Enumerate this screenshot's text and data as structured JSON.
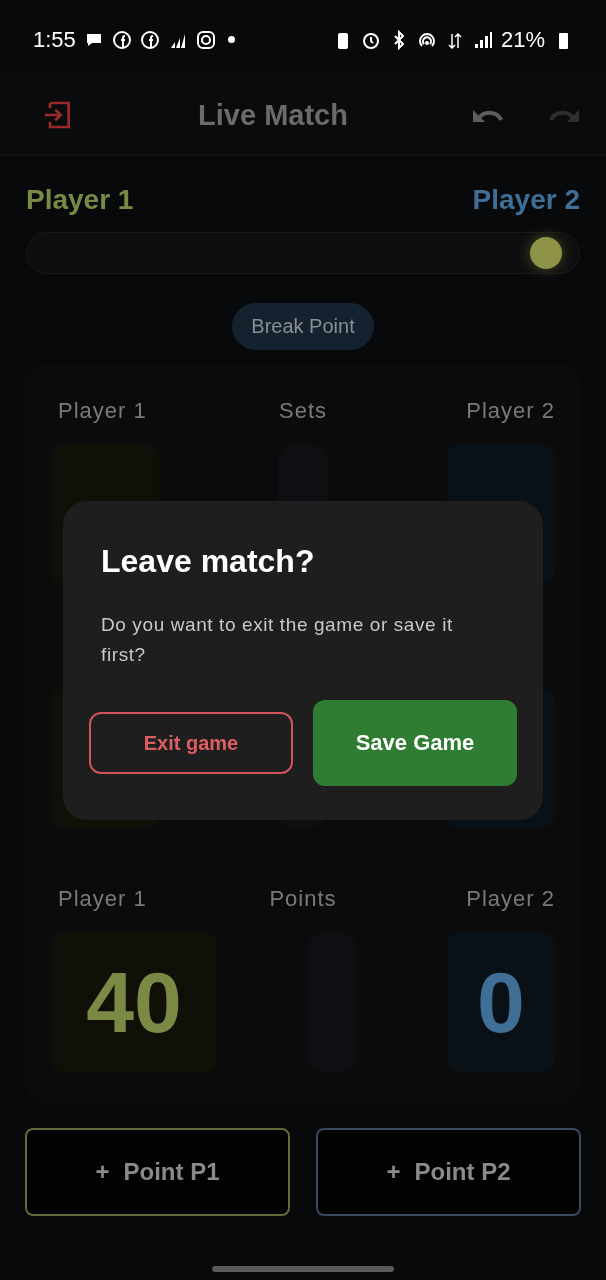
{
  "status_bar": {
    "time": "1:55",
    "battery_text": "21%"
  },
  "app_bar": {
    "title": "Live Match"
  },
  "players": [
    {
      "name": "Player 1",
      "color": "#7a8a45"
    },
    {
      "name": "Player 2",
      "color": "#3f6f96"
    }
  ],
  "momentum": {
    "level": 0.94
  },
  "badge": "Break Point",
  "sections": [
    {
      "kind": "sets",
      "labels": [
        "Player 1",
        "Sets",
        "Player 2"
      ]
    },
    {
      "kind": "games"
    },
    {
      "kind": "points",
      "labels": [
        "Player 1",
        "Points",
        "Player 2"
      ],
      "p1_value": "40",
      "p2_value": "0"
    }
  ],
  "point_buttons": [
    {
      "icon": "+",
      "label": "Point P1"
    },
    {
      "icon": "+",
      "label": "Point P2"
    }
  ],
  "dialog": {
    "title": "Leave match?",
    "message": "Do you want to exit the game or save it first?",
    "buttons": [
      {
        "kind": "outlined",
        "label": "Exit game"
      },
      {
        "kind": "filled",
        "label": "Save Game"
      }
    ]
  }
}
